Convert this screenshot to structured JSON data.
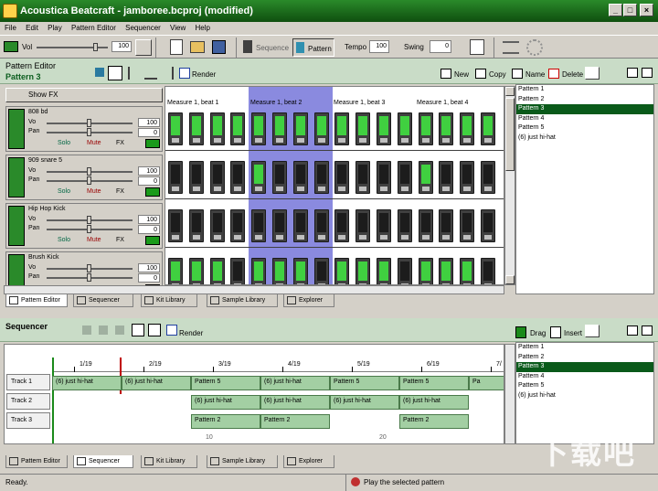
{
  "window": {
    "title": "Acoustica Beatcraft - jamboree.bcproj (modified)"
  },
  "menu": [
    "File",
    "Edit",
    "Play",
    "Pattern Editor",
    "Sequencer",
    "View",
    "Help"
  ],
  "toolbar": {
    "volume_label": "Vol",
    "volume_value": "100",
    "sequence_label": "Sequence",
    "pattern_label": "Pattern",
    "tempo_label": "Tempo",
    "tempo_value": "100",
    "swing_label": "Swing",
    "swing_value": "0"
  },
  "pattern_editor": {
    "title": "Pattern Editor",
    "pattern_name": "Pattern 3",
    "render_label": "Render",
    "new_label": "New",
    "copy_label": "Copy",
    "name_label": "Name",
    "delete_label": "Delete",
    "show_fx_label": "Show FX",
    "measures": [
      "Measure 1, beat 1",
      "Measure 1, beat 2",
      "Measure 1, beat 3",
      "Measure 1, beat 4"
    ],
    "instruments": [
      {
        "name": "808 bd",
        "vol": "100",
        "pan": "0",
        "solo": "Solo",
        "mute": "Mute",
        "fx": "FX",
        "steps": [
          1,
          1,
          1,
          1,
          1,
          1,
          1,
          1,
          1,
          1,
          1,
          1,
          1,
          1,
          1,
          1
        ]
      },
      {
        "name": "909 snare 5",
        "vol": "100",
        "pan": "0",
        "solo": "Solo",
        "mute": "Mute",
        "fx": "FX",
        "steps": [
          0,
          0,
          0,
          0,
          1,
          0,
          0,
          0,
          0,
          0,
          0,
          0,
          1,
          0,
          0,
          0
        ]
      },
      {
        "name": "Hip Hop Kick",
        "vol": "100",
        "pan": "0",
        "solo": "Solo",
        "mute": "Mute",
        "fx": "FX",
        "steps": [
          0,
          0,
          0,
          0,
          0,
          0,
          0,
          0,
          0,
          0,
          0,
          0,
          0,
          0,
          0,
          0
        ]
      },
      {
        "name": "Brush Kick",
        "vol": "100",
        "pan": "0",
        "solo": "Solo",
        "mute": "Mute",
        "fx": "FX",
        "steps": [
          1,
          1,
          1,
          0,
          1,
          1,
          1,
          0,
          1,
          1,
          1,
          0,
          1,
          1,
          1,
          0
        ]
      }
    ],
    "pattern_list": [
      "Pattern 1",
      "Pattern 2",
      "Pattern 3",
      "Pattern 4",
      "Pattern 5",
      "(6) just hi-hat"
    ],
    "selected_pattern_index": 2
  },
  "tabs_top": [
    "Pattern Editor",
    "Sequencer",
    "Kit Library",
    "Sample Library",
    "Explorer"
  ],
  "sequencer": {
    "title": "Sequencer",
    "render_label": "Render",
    "drag_label": "Drag",
    "insert_label": "Insert",
    "timeline": [
      "1/19",
      "2/19",
      "3/19",
      "4/19",
      "5/19",
      "6/19",
      "7/"
    ],
    "tracks": [
      {
        "name": "Track 1",
        "clips": [
          "(6) just hi-hat",
          "(6) just hi-hat",
          "Pattern 5",
          "(6) just hi-hat",
          "Pattern 5",
          "Pattern 5",
          "Pa"
        ]
      },
      {
        "name": "Track 2",
        "clips": [
          "(6) just hi-hat",
          "(6) just hi-hat",
          "(6) just hi-hat",
          "(6) just hi-hat"
        ]
      },
      {
        "name": "Track 3",
        "clips": [
          "Pattern 2",
          "Pattern 2",
          "Pattern 2"
        ]
      }
    ],
    "ruler_numbers": [
      "10",
      "20"
    ],
    "pattern_list": [
      "Pattern 1",
      "Pattern 2",
      "Pattern 3",
      "Pattern 4",
      "Pattern 5",
      "(6) just hi-hat"
    ],
    "selected_pattern_index": 2
  },
  "tabs_bottom": [
    "Pattern Editor",
    "Sequencer",
    "Kit Library",
    "Sample Library",
    "Explorer"
  ],
  "status": {
    "left": "Ready.",
    "right": "Play the selected pattern"
  },
  "watermark": "下载吧",
  "colors": {
    "title_green": "#2a8a2a",
    "selected_green": "#0a5a1a",
    "beat_highlight": "#8a8adf",
    "led_on": "#40d040"
  }
}
